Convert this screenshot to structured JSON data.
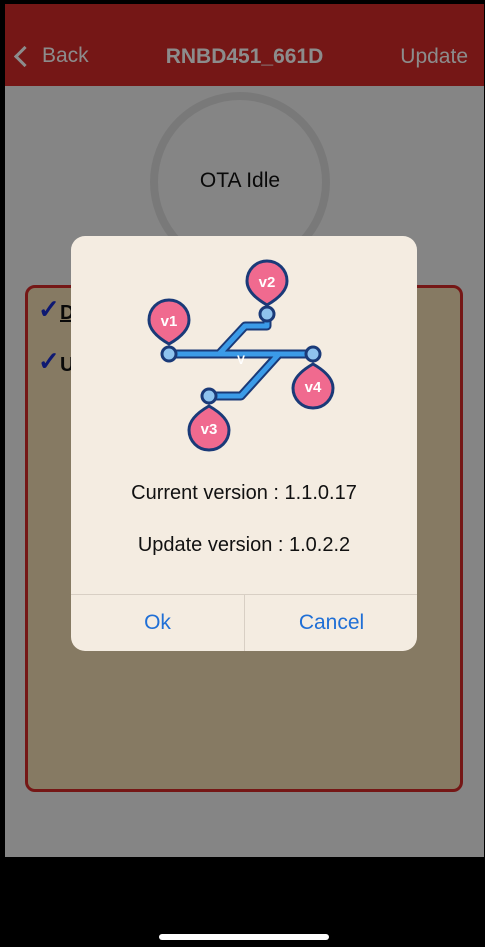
{
  "navbar": {
    "back_label": "Back",
    "title": "RNBD451_661D",
    "update_label": "Update"
  },
  "status": {
    "ring_label": "OTA Idle"
  },
  "panel": {
    "item1_label": "Do",
    "item2_label": "U"
  },
  "dialog": {
    "current_version": "Current version : 1.1.0.17",
    "update_version": "Update version : 1.0.2.2",
    "ok_label": "Ok",
    "cancel_label": "Cancel",
    "icon": {
      "v1": "v1",
      "v2": "v2",
      "v3": "v3",
      "v4": "v4",
      "center_glyph": "V"
    }
  },
  "colors": {
    "navbar": "#d52b28",
    "accent_blue": "#1f6fd6",
    "panel_fill": "#f5dfb4",
    "pin_pink": "#f06a8f"
  }
}
